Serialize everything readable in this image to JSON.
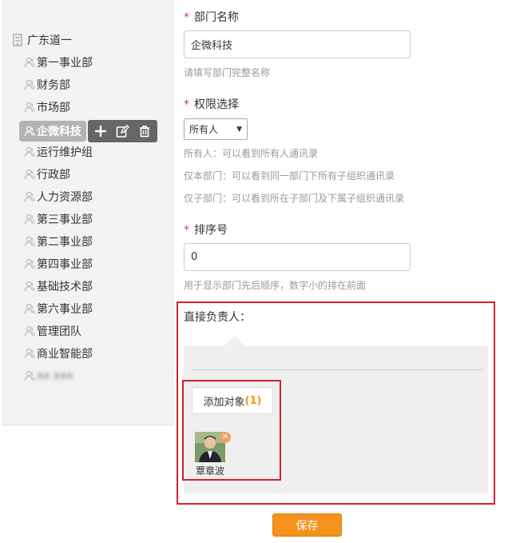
{
  "sidebar": {
    "root": {
      "label": "广东道一",
      "icon": "building-icon"
    },
    "items": [
      {
        "label": "第一事业部"
      },
      {
        "label": "财务部"
      },
      {
        "label": "市场部"
      },
      {
        "label": "企微科技"
      },
      {
        "label": "运行维护组"
      },
      {
        "label": "行政部"
      },
      {
        "label": "人力资源部"
      },
      {
        "label": "第三事业部"
      },
      {
        "label": "第二事业部"
      },
      {
        "label": "第四事业部"
      },
      {
        "label": "基础技术部"
      },
      {
        "label": "第六事业部"
      },
      {
        "label": "管理团队"
      },
      {
        "label": "商业智能部"
      },
      {
        "label": "xx xxx"
      }
    ],
    "active_index": 3,
    "actions": {
      "add": "plus-icon",
      "edit": "edit-icon",
      "delete": "trash-icon"
    }
  },
  "form": {
    "dept_name": {
      "required": "*",
      "label": "部门名称",
      "value": "企微科技",
      "hint": "请填写部门完整名称"
    },
    "permission": {
      "required": "*",
      "label": "权限选择",
      "selected": "所有人",
      "hints": [
        "所有人：可以看到所有人通讯录",
        "仅本部门：可以看到同一部门下所有子组织通讯录",
        "仅子部门：可以看到所在子部门及下属子组织通讯录"
      ]
    },
    "sort": {
      "required": "*",
      "label": "排序号",
      "value": "0",
      "hint": "用于显示部门先后顺序，数字小的排在前面"
    },
    "responsible": {
      "label": "直接负责人：",
      "add_label": "添加对象",
      "count": "(1)",
      "person_name": "覃章波",
      "remove_icon": "close-icon"
    },
    "save_label": "保存"
  },
  "colors": {
    "accent": "#f4921c",
    "highlight_border": "#d4212b",
    "required": "#e4393c",
    "count": "#f39800"
  }
}
